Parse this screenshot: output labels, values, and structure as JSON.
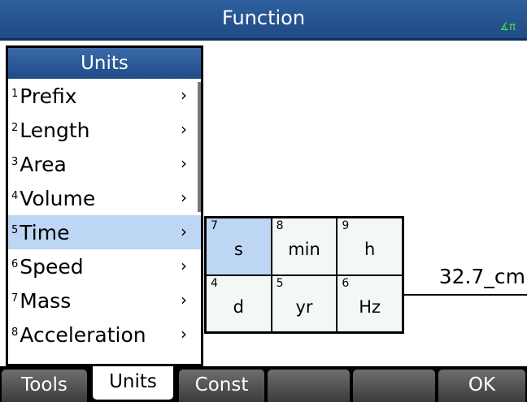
{
  "header": {
    "title": "Function",
    "angle_indicator": "∡π"
  },
  "result": {
    "value": "32.7_cm"
  },
  "menu": {
    "title": "Units",
    "items": [
      {
        "num": "1",
        "label": "Prefix",
        "chevron": "›"
      },
      {
        "num": "2",
        "label": "Length",
        "chevron": "›"
      },
      {
        "num": "3",
        "label": "Area",
        "chevron": "›"
      },
      {
        "num": "4",
        "label": "Volume",
        "chevron": "›"
      },
      {
        "num": "5",
        "label": "Time",
        "chevron": "›",
        "selected": true
      },
      {
        "num": "6",
        "label": "Speed",
        "chevron": "›"
      },
      {
        "num": "7",
        "label": "Mass",
        "chevron": "›"
      },
      {
        "num": "8",
        "label": "Acceleration",
        "chevron": "›"
      }
    ]
  },
  "picker": {
    "cells": [
      {
        "key": "7",
        "label": "s",
        "selected": true
      },
      {
        "key": "8",
        "label": "min"
      },
      {
        "key": "9",
        "label": "h"
      },
      {
        "key": "4",
        "label": "d"
      },
      {
        "key": "5",
        "label": "yr"
      },
      {
        "key": "6",
        "label": "Hz"
      }
    ]
  },
  "softkeys": [
    {
      "label": "Tools"
    },
    {
      "label": "Units",
      "active": true
    },
    {
      "label": "Const"
    },
    {
      "label": ""
    },
    {
      "label": ""
    },
    {
      "label": "OK"
    }
  ],
  "colors": {
    "title_bar": "#1f4b86",
    "highlight": "#bcd6f4",
    "angle_indicator": "#3ee83e"
  }
}
